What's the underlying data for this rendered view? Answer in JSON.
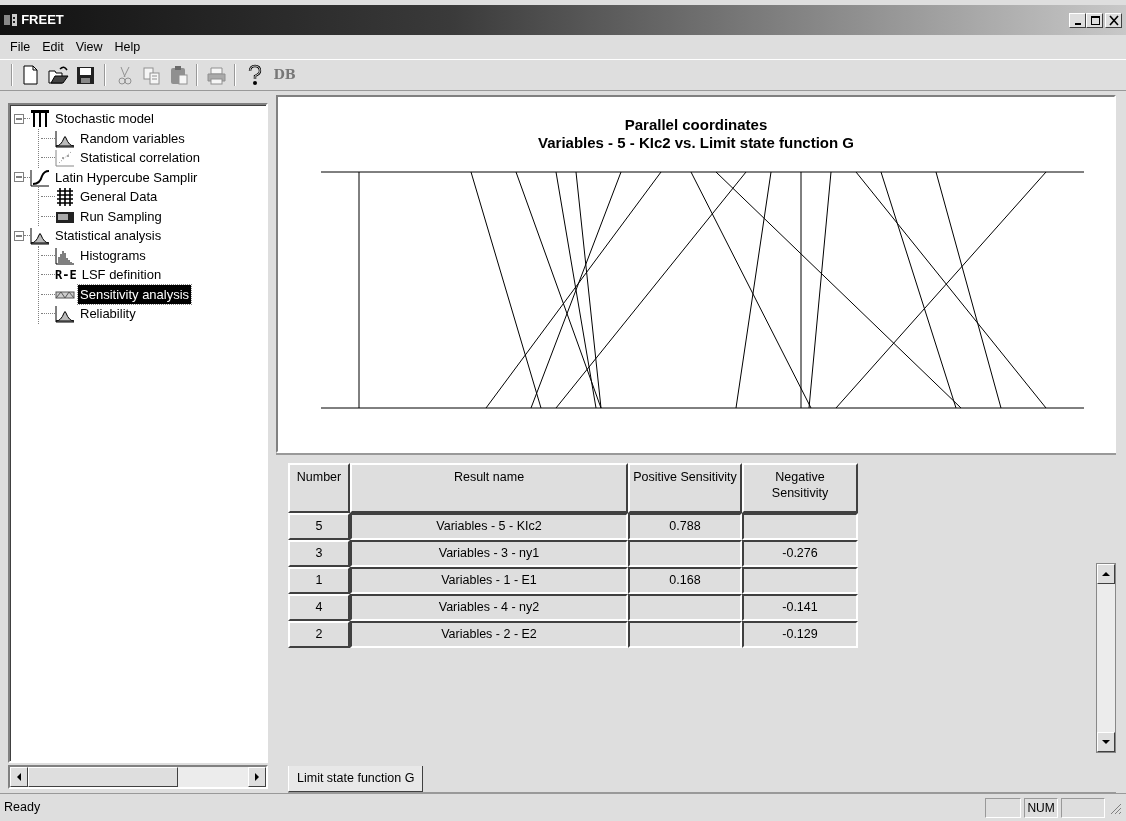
{
  "window": {
    "title": "FREET"
  },
  "menu": [
    "File",
    "Edit",
    "View",
    "Help"
  ],
  "toolbar": [
    {
      "kind": "new",
      "disabled": false
    },
    {
      "kind": "open",
      "disabled": false
    },
    {
      "kind": "save",
      "disabled": false
    },
    {
      "kind": "separator"
    },
    {
      "kind": "cut",
      "disabled": true
    },
    {
      "kind": "copy",
      "disabled": true
    },
    {
      "kind": "paste",
      "disabled": true
    },
    {
      "kind": "separator"
    },
    {
      "kind": "print",
      "disabled": true
    },
    {
      "kind": "separator"
    },
    {
      "kind": "help",
      "disabled": false
    },
    {
      "kind": "text",
      "label": "DB",
      "disabled": true
    }
  ],
  "tree": [
    {
      "label": "Stochastic model",
      "kind": "model",
      "expanded": true,
      "selected": false,
      "children": [
        {
          "label": "Random variables",
          "kind": "distribution",
          "selected": false
        },
        {
          "label": "Statistical correlation",
          "kind": "scatter",
          "selected": false
        }
      ]
    },
    {
      "label": "Latin Hypercube Samplir",
      "kind": "curve",
      "expanded": true,
      "selected": false,
      "children": [
        {
          "label": "General Data",
          "kind": "grid",
          "selected": false
        },
        {
          "label": "Run Sampling",
          "kind": "calculator",
          "selected": false
        }
      ]
    },
    {
      "label": "Statistical analysis",
      "kind": "distribution",
      "expanded": true,
      "selected": false,
      "children": [
        {
          "label": "Histograms",
          "kind": "histogram",
          "selected": false
        },
        {
          "label": "LSF definition",
          "kind": "text",
          "badge": "R-E",
          "selected": false
        },
        {
          "label": "Sensitivity analysis",
          "kind": "band",
          "selected": true
        },
        {
          "label": "Reliability",
          "kind": "distribution",
          "selected": false
        }
      ]
    }
  ],
  "chart": {
    "title": "Parallel coordinates",
    "subtitle": "Variables - 5 - KIc2 vs. Limit state function G"
  },
  "table": {
    "columns": [
      "Number",
      "Result name",
      "Positive Sensitivity",
      "Negative Sensitivity"
    ],
    "rows": [
      {
        "number": "5",
        "name": "Variables - 5 - KIc2",
        "positive": "0.788"
      },
      {
        "number": "3",
        "name": "Variables - 3 - ny1",
        "negative": "-0.276"
      },
      {
        "number": "1",
        "name": "Variables - 1 - E1",
        "positive": "0.168"
      },
      {
        "number": "4",
        "name": "Variables - 4 - ny2",
        "negative": "-0.141"
      },
      {
        "number": "2",
        "name": "Variables - 2 - E2",
        "negative": "-0.129"
      }
    ]
  },
  "tabs": [
    {
      "label": "Limit state function G",
      "selected": true
    }
  ],
  "status_bar": {
    "text": "Ready",
    "indicators": [
      "NUM"
    ]
  }
}
